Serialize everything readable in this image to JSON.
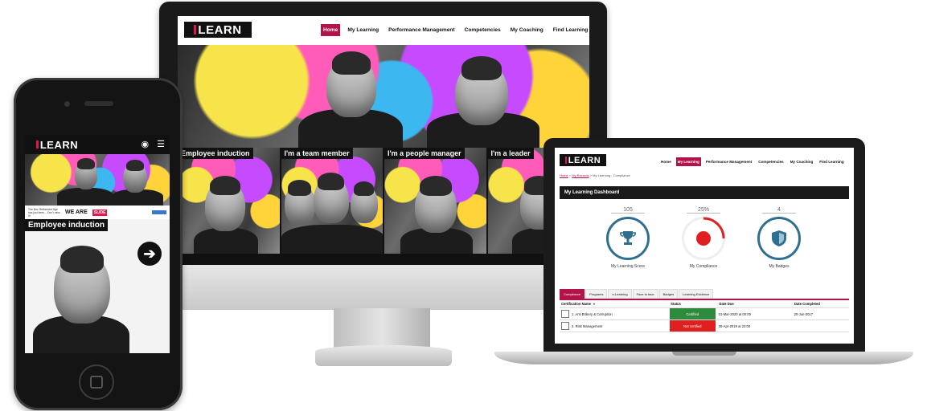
{
  "brand": {
    "logo_text": "LEARN",
    "accent_color": "#b3124a",
    "logo_bar_color": "#e3174e"
  },
  "desktop": {
    "nav": [
      {
        "label": "Home",
        "active": true
      },
      {
        "label": "My Learning",
        "active": false
      },
      {
        "label": "Performance Management",
        "active": false
      },
      {
        "label": "Competencies",
        "active": false
      },
      {
        "label": "My Coaching",
        "active": false
      },
      {
        "label": "Find Learning",
        "active": false
      }
    ],
    "tiles": [
      {
        "label": "Employee induction"
      },
      {
        "label": "I'm a team member"
      },
      {
        "label": "I'm a people manager"
      },
      {
        "label": "I'm a leader"
      }
    ]
  },
  "laptop": {
    "nav": [
      {
        "label": "Home",
        "active": false
      },
      {
        "label": "My Learning",
        "active": true
      },
      {
        "label": "Performance Management",
        "active": false
      },
      {
        "label": "Competencies",
        "active": false
      },
      {
        "label": "My Coaching",
        "active": false
      },
      {
        "label": "Find Learning",
        "active": false
      }
    ],
    "breadcrumb": {
      "home": "Home",
      "sep1": " > ",
      "link": "My Records",
      "rest": " > My Learning - Compliance"
    },
    "dashboard_title": "My Learning Dashboard",
    "stats": [
      {
        "value": "105",
        "label": "My Learning Score",
        "icon": "trophy-icon"
      },
      {
        "value": "25%",
        "label": "My Compliance",
        "icon": "progress-ring-icon",
        "progress": 0.25
      },
      {
        "value": "4",
        "label": "My Badges",
        "icon": "shield-icon"
      }
    ],
    "tabs": [
      {
        "label": "Compliance",
        "active": true
      },
      {
        "label": "Programs",
        "active": false
      },
      {
        "label": "e-Learning",
        "active": false
      },
      {
        "label": "Face to face",
        "active": false
      },
      {
        "label": "Badges",
        "active": false
      },
      {
        "label": "Learning Evidence",
        "active": false
      }
    ],
    "table": {
      "headers": [
        "Certification Name",
        "Status",
        "Date Due",
        "Date Completed"
      ],
      "rows": [
        {
          "name": "1. Anti Bribery & Corruption",
          "status": "Certified",
          "status_color": "#2e8b3d",
          "due": "01-Mar-2020 at 00:00",
          "completed": "20-Jun-2017"
        },
        {
          "name": "2. Risk Management",
          "status": "Not certified",
          "status_color": "#e02020",
          "due": "30-Apr-2019 at 23:00",
          "completed": ""
        }
      ]
    }
  },
  "mobile": {
    "strip_text": "The Box Retirement Age has just been... Don't miss it!",
    "strip_headline": "WE ARE",
    "strip_badge": "SLIDE",
    "card_label": "Employee induction",
    "arrow_glyph": "➔",
    "user_glyph": "◉",
    "menu_glyph": "☰"
  }
}
